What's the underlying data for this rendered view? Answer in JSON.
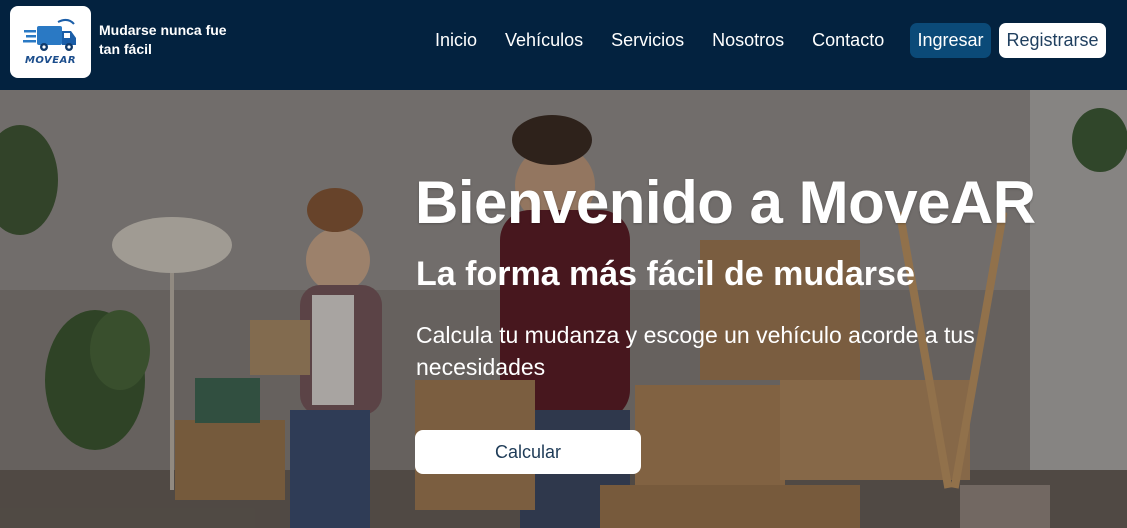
{
  "brand": {
    "logo_text": "MOVEAR",
    "tagline": "Mudarse nunca fue tan fácil"
  },
  "nav": {
    "links": [
      {
        "label": "Inicio"
      },
      {
        "label": "Vehículos"
      },
      {
        "label": "Servicios"
      },
      {
        "label": "Nosotros"
      },
      {
        "label": "Contacto"
      }
    ],
    "login_label": "Ingresar",
    "register_label": "Registrarse"
  },
  "hero": {
    "title": "Bienvenido a MoveAR",
    "subtitle": "La forma más fácil de mudarse",
    "description": "Calcula tu mudanza y escoge un vehículo acorde a tus necesidades",
    "cta_label": "Calcular"
  },
  "colors": {
    "navbar_bg": "#03223f",
    "login_button_bg": "#0b4a78",
    "register_button_bg": "#ffffff",
    "cta_bg": "#ffffff"
  },
  "icons": {
    "logo": "moving-truck-icon"
  }
}
